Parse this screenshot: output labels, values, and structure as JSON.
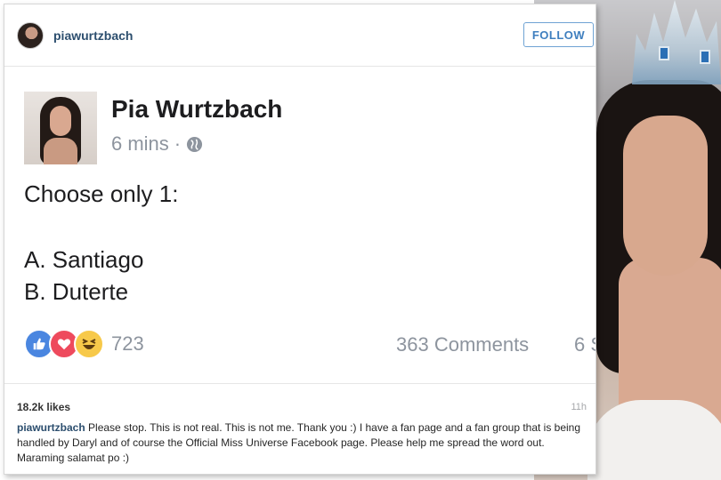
{
  "instagram": {
    "username": "piawurtzbach",
    "follow_label": "FOLLOW",
    "likes": "18.2k likes",
    "time": "11h",
    "caption_username": "piawurtzbach",
    "caption_text": "Please stop. This is not real. This is not me. Thank you :) I have a fan page and a fan group that is being handled by Daryl and of course the Official Miss Universe Facebook page. Please help me spread the word out. Maraming salamat po :)"
  },
  "post": {
    "author": "Pia Wurtzbach",
    "time": "6 mins",
    "separator": "·",
    "line1": "Choose only 1:",
    "option_a": "A. Santiago",
    "option_b": "B. Duterte",
    "reaction_count": "723",
    "comments": "363 Comments",
    "shares_partial": "6 S"
  },
  "icons": {
    "privacy": "globe-icon",
    "reactions": [
      "like-icon",
      "love-icon",
      "haha-icon"
    ]
  },
  "colors": {
    "username": "#2c4e6e",
    "follow": "#3f7fbf",
    "like": "#4a86e0",
    "love": "#ee4a5d",
    "haha": "#f7c94a",
    "muted": "#8d949e"
  }
}
